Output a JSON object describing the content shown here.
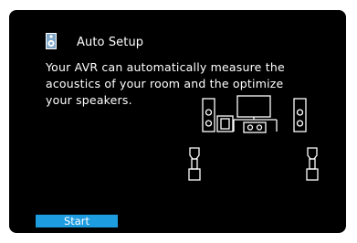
{
  "header": {
    "title": "Auto Setup",
    "icon": "speaker-icon"
  },
  "description": {
    "line1": "Your AVR can automatically measure the",
    "line2": "acoustics of your room and the optimize",
    "line3": "your speakers."
  },
  "actions": {
    "start_label": "Start"
  },
  "colors": {
    "background": "#000000",
    "text": "#ffffff",
    "accent": "#1e9ce0"
  },
  "diagram": {
    "icons": [
      "front-left-speaker-icon",
      "subwoofer-icon",
      "tv-icon",
      "center-speaker-icon",
      "front-right-speaker-icon",
      "surround-left-speaker-icon",
      "surround-right-speaker-icon"
    ]
  }
}
